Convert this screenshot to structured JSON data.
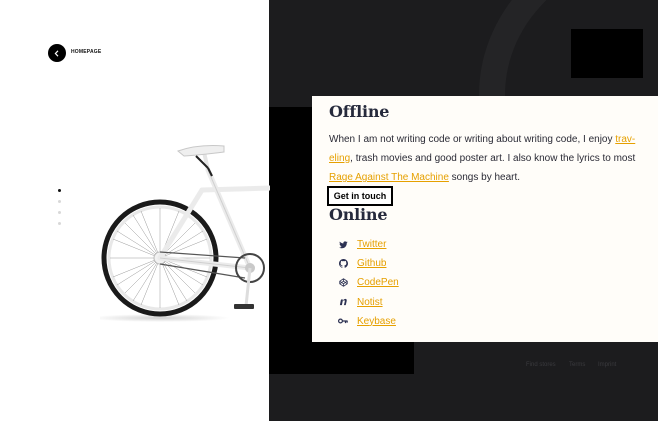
{
  "nav": {
    "home_label": "HOMEPAGE"
  },
  "pager": {
    "count": 4,
    "active_index": 0
  },
  "offline": {
    "title": "Offline",
    "text_1": "When I am not writing code or writing about writing code, I enjoy ",
    "link_traveling_part1": "trav-",
    "link_traveling_part2": "eling",
    "text_2": ", trash movies and good poster art. I also know the lyrics to most ",
    "link_ratm": "Rage Against The Machine",
    "text_3": " songs by heart."
  },
  "cta": {
    "label": "Get in touch"
  },
  "online": {
    "title": "Online",
    "links": [
      {
        "label": "Twitter",
        "icon": "twitter-icon"
      },
      {
        "label": "Github",
        "icon": "github-icon"
      },
      {
        "label": "CodePen",
        "icon": "codepen-icon"
      },
      {
        "label": "Notist",
        "icon": "notist-icon"
      },
      {
        "label": "Keybase",
        "icon": "keybase-icon"
      }
    ]
  },
  "footer": {
    "find_stores": "Find stores",
    "terms": "Terms",
    "imprint": "Imprint"
  },
  "colors": {
    "link": "#e6a000",
    "dark_bg": "#1c1c1e",
    "card_bg": "#fffdf9"
  }
}
